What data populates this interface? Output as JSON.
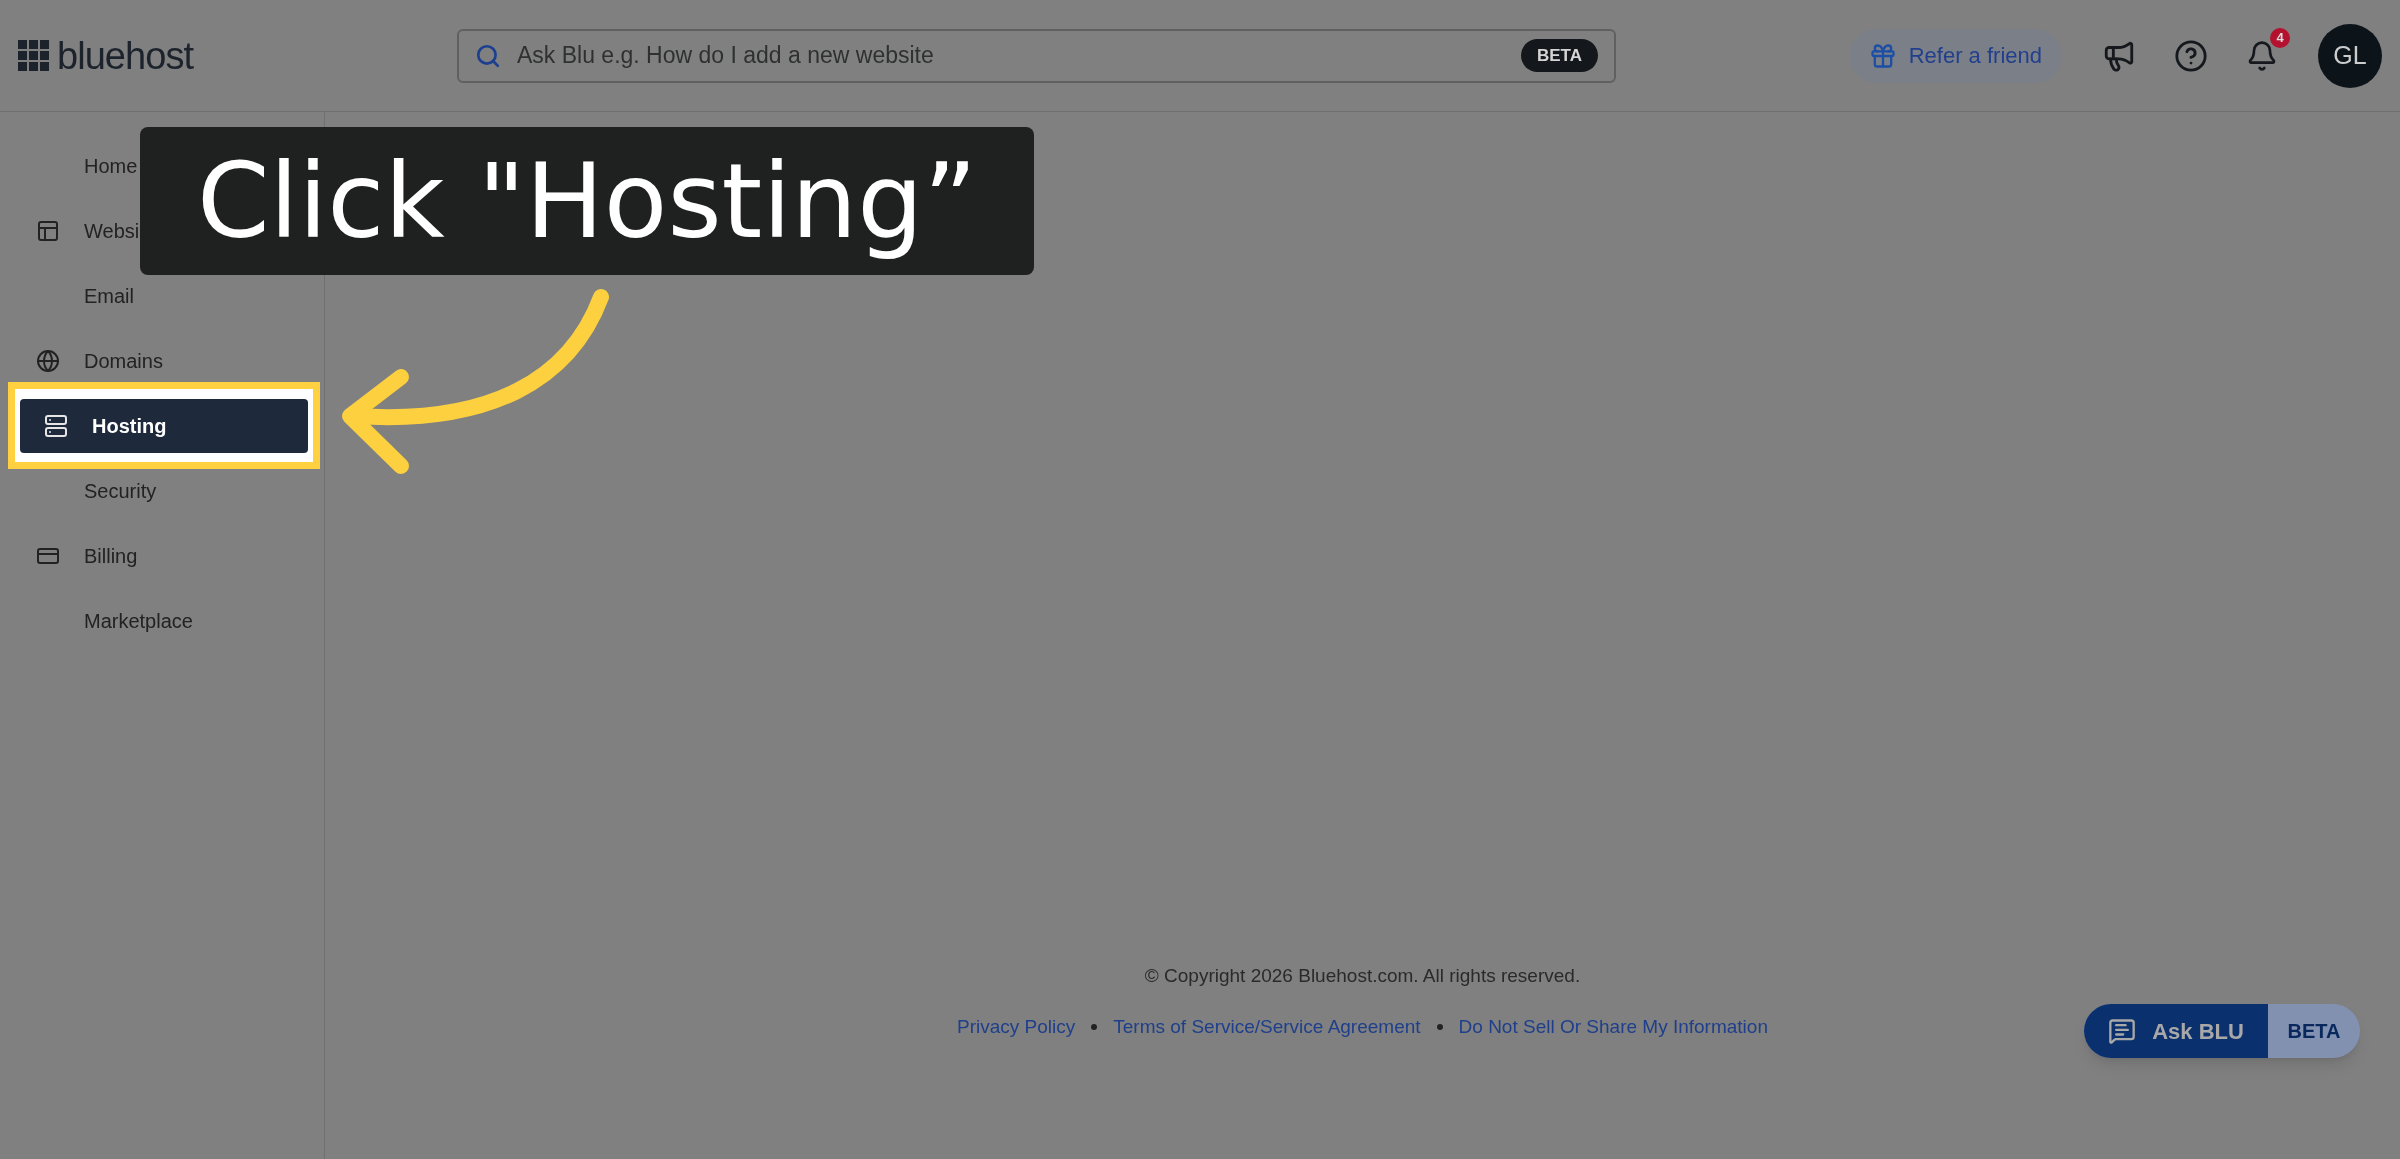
{
  "header": {
    "logo": "bluehost",
    "search": {
      "placeholder": "Ask Blu e.g. How do I add a new website",
      "badge": "BETA"
    },
    "refer_button": "Refer a friend",
    "notifications_count": "4",
    "avatar": "GL"
  },
  "sidebar": {
    "items": [
      {
        "label": "Home",
        "kind": "plain",
        "selected": false
      },
      {
        "label": "Websi",
        "kind": "icon",
        "selected": false
      },
      {
        "label": "Email",
        "kind": "plain",
        "selected": false
      },
      {
        "label": "Domains",
        "kind": "icon",
        "selected": false
      },
      {
        "label": "Hosting",
        "kind": "icon",
        "selected": true
      },
      {
        "label": "Security",
        "kind": "plain",
        "selected": false
      },
      {
        "label": "Billing",
        "kind": "icon",
        "selected": false
      },
      {
        "label": "Marketplace",
        "kind": "plain",
        "selected": false
      }
    ]
  },
  "callout": {
    "text": "Click \"Hosting”"
  },
  "footer": {
    "copyright": "© Copyright 2026 Bluehost.com. All rights reserved.",
    "links": [
      "Privacy Policy",
      "Terms of Service/Service Agreement",
      "Do Not Sell Or Share My Information"
    ]
  },
  "ask_blu": {
    "label": "Ask BLU",
    "badge": "BETA"
  }
}
